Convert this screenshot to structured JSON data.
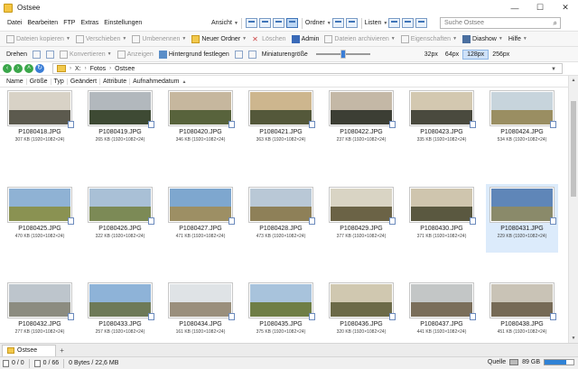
{
  "window": {
    "title": "Ostsee"
  },
  "menu": {
    "items": [
      "Datei",
      "Bearbeiten",
      "FTP",
      "Extras",
      "Einstellungen"
    ],
    "ansicht": "Ansicht",
    "ordner": "Ordner",
    "listen": "Listen"
  },
  "search": {
    "placeholder": "Suche Ostsee"
  },
  "toolbar1": {
    "copy": "Dateien kopieren",
    "move": "Verschieben",
    "rename": "Umbenennen",
    "new_folder": "Neuer Ordner",
    "delete": "Löschen",
    "admin": "Admin",
    "archive": "Dateien archivieren",
    "properties": "Eigenschaften",
    "slideshow": "Diashow",
    "help": "Hilfe"
  },
  "toolbar2": {
    "rotate": "Drehen",
    "convert": "Konvertieren",
    "view": "Anzeigen",
    "wallpaper": "Hintergrund festlegen",
    "thumb_size_label": "Miniaturengröße",
    "thumb_size_level": 0.5,
    "sizes": [
      "32px",
      "64px",
      "128px",
      "256px"
    ],
    "active_size": "128px"
  },
  "address": {
    "crumbs": [
      "X:",
      "Fotos",
      "Ostsee"
    ]
  },
  "columns": [
    "Name",
    "Größe",
    "Typ",
    "Geändert",
    "Attribute",
    "Aufnahmedatum"
  ],
  "files": [
    {
      "name": "P1080418.JPG",
      "info": "307 KB (1920×1082×24)",
      "sky": "#d8d2c6",
      "ground": "#5c5a4e"
    },
    {
      "name": "P1080419.JPG",
      "info": "265 KB (1920×1082×24)",
      "sky": "#b2b8bd",
      "ground": "#3e4a34"
    },
    {
      "name": "P1080420.JPG",
      "info": "346 KB (1920×1082×24)",
      "sky": "#c6b79e",
      "ground": "#58633c"
    },
    {
      "name": "P1080421.JPG",
      "info": "363 KB (1920×1082×24)",
      "sky": "#cdb68e",
      "ground": "#54583a"
    },
    {
      "name": "P1080422.JPG",
      "info": "237 KB (1920×1082×24)",
      "sky": "#c4b8a6",
      "ground": "#3c3e34"
    },
    {
      "name": "P1080423.JPG",
      "info": "335 KB (1920×1082×24)",
      "sky": "#d3c8b0",
      "ground": "#4a4a3e"
    },
    {
      "name": "P1080424.JPG",
      "info": "534 KB (1920×1082×24)",
      "sky": "#c7d4dc",
      "ground": "#9a8e62"
    },
    {
      "name": "P1080425.JPG",
      "info": "470 KB (1920×1082×24)",
      "sky": "#8fb2d4",
      "ground": "#8a9252"
    },
    {
      "name": "P1080426.JPG",
      "info": "322 KB (1920×1082×24)",
      "sky": "#a9c0d6",
      "ground": "#7c8a56"
    },
    {
      "name": "P1080427.JPG",
      "info": "471 KB (1920×1082×24)",
      "sky": "#7ea7cf",
      "ground": "#9d8f64"
    },
    {
      "name": "P1080428.JPG",
      "info": "473 KB (1920×1082×24)",
      "sky": "#b9c8d6",
      "ground": "#8e8058"
    },
    {
      "name": "P1080429.JPG",
      "info": "377 KB (1920×1082×24)",
      "sky": "#d9d4c4",
      "ground": "#6b6346"
    },
    {
      "name": "P1080430.JPG",
      "info": "371 KB (1920×1082×24)",
      "sky": "#cfc5ae",
      "ground": "#5a5840"
    },
    {
      "name": "P1080431.JPG",
      "info": "229 KB (1920×1082×24)",
      "sky": "#5f86b8",
      "ground": "#8a8a6a"
    },
    {
      "name": "P1080432.JPG",
      "info": "277 KB (1920×1082×24)",
      "sky": "#bdc5cc",
      "ground": "#8c8c80"
    },
    {
      "name": "P1080433.JPG",
      "info": "257 KB (1920×1082×24)",
      "sky": "#8eb3d8",
      "ground": "#6e7a58"
    },
    {
      "name": "P1080434.JPG",
      "info": "161 KB (1920×1082×24)",
      "sky": "#dfe3e6",
      "ground": "#9a8f7c"
    },
    {
      "name": "P1080435.JPG",
      "info": "375 KB (1920×1082×24)",
      "sky": "#a8c3dc",
      "ground": "#6f7e46"
    },
    {
      "name": "P1080436.JPG",
      "info": "320 KB (1920×1082×24)",
      "sky": "#d0c8b0",
      "ground": "#6c6a48"
    },
    {
      "name": "P1080437.JPG",
      "info": "441 KB (1920×1082×24)",
      "sky": "#c3c6c6",
      "ground": "#7a6e5a"
    },
    {
      "name": "P1080438.JPG",
      "info": "451 KB (1920×1082×24)",
      "sky": "#c9c3b6",
      "ground": "#766a56"
    }
  ],
  "selected_file": "P1080431.JPG",
  "tabs": [
    {
      "label": "Ostsee"
    }
  ],
  "status": {
    "selected": "0 / 0",
    "count": "0 / 66",
    "size": "0 Bytes / 22,6 MB",
    "source_label": "Quelle",
    "disk": "89 GB",
    "disk_used_fraction": 0.75
  },
  "colors": {
    "accent": "#3a7dd6",
    "selection": "#dcebfb"
  }
}
